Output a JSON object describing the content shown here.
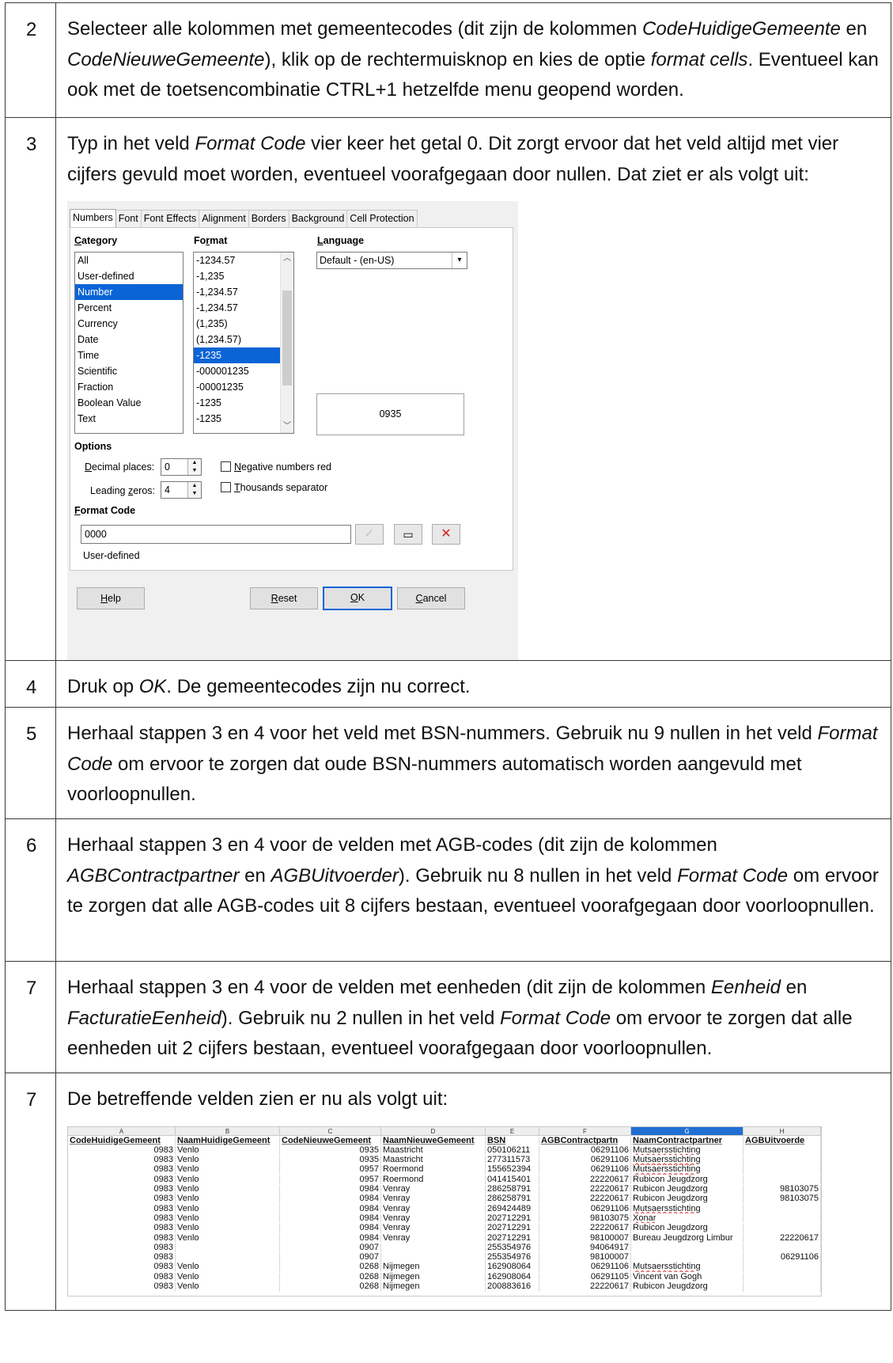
{
  "steps": [
    {
      "number": "2",
      "segments": [
        {
          "t": "Selecteer alle kolommen met gemeentecodes (dit zijn de kolommen "
        },
        {
          "t": "CodeHuidigeGemeente",
          "i": true
        },
        {
          "t": " en "
        },
        {
          "t": "CodeNieuweGemeente",
          "i": true
        },
        {
          "t": "), klik op de rechtermuisknop en kies de optie "
        },
        {
          "t": "format cells",
          "i": true
        },
        {
          "t": ". Eventueel kan ook met de toetsencombinatie CTRL+1 hetzelfde menu geopend worden."
        }
      ]
    },
    {
      "number": "3",
      "segments": [
        {
          "t": "Typ in het veld "
        },
        {
          "t": "Format Code",
          "i": true
        },
        {
          "t": " vier keer het getal 0. Dit zorgt ervoor dat het veld altijd met vier cijfers gevuld moet worden, eventueel voorafgegaan door nullen. Dat ziet er als volgt uit:"
        }
      ]
    },
    {
      "number": "4",
      "segments": [
        {
          "t": "Druk op "
        },
        {
          "t": "OK",
          "i": true
        },
        {
          "t": ". De gemeentecodes zijn nu correct."
        }
      ]
    },
    {
      "number": "5",
      "segments": [
        {
          "t": "Herhaal stappen 3 en 4 voor het veld met BSN-nummers. Gebruik nu 9 nullen in het veld "
        },
        {
          "t": "Format Code",
          "i": true
        },
        {
          "t": " om ervoor te zorgen dat oude BSN-nummers automatisch worden aangevuld met voorloopnullen."
        }
      ]
    },
    {
      "number": "6",
      "segments": [
        {
          "t": "Herhaal stappen 3 en 4 voor de velden met AGB-codes (dit zijn de kolommen "
        },
        {
          "t": "AGBContractpartner",
          "i": true
        },
        {
          "t": " en "
        },
        {
          "t": "AGBUitvoerder",
          "i": true
        },
        {
          "t": "). Gebruik nu 8 nullen in het veld "
        },
        {
          "t": "Format Code",
          "i": true
        },
        {
          "t": " om ervoor te zorgen dat alle AGB-codes uit 8 cijfers bestaan, eventueel voorafgegaan door voorloopnullen."
        }
      ]
    },
    {
      "number": "7",
      "segments": [
        {
          "t": "Herhaal stappen 3 en 4 voor de velden met eenheden (dit zijn de kolommen "
        },
        {
          "t": "Eenheid",
          "i": true
        },
        {
          "t": " en "
        },
        {
          "t": "FacturatieEenheid",
          "i": true
        },
        {
          "t": "). Gebruik nu 2 nullen in het veld "
        },
        {
          "t": "Format Code",
          "i": true
        },
        {
          "t": " om ervoor te zorgen dat alle eenheden uit 2 cijfers bestaan, eventueel voorafgegaan door voorloopnullen."
        }
      ]
    },
    {
      "number": "7",
      "segments": [
        {
          "t": "De betreffende velden zien er nu als volgt uit:"
        }
      ]
    }
  ],
  "dialog": {
    "tabs": [
      "Numbers",
      "Font",
      "Font Effects",
      "Alignment",
      "Borders",
      "Background",
      "Cell Protection"
    ],
    "active_tab": "Numbers",
    "category_label": "Category",
    "categories": [
      "All",
      "User-defined",
      "Number",
      "Percent",
      "Currency",
      "Date",
      "Time",
      "Scientific",
      "Fraction",
      "Boolean Value",
      "Text"
    ],
    "selected_category": "Number",
    "format_label": "Format",
    "formats": [
      "-1234.57",
      "-1,235",
      "-1,234.57",
      "-1,234.57",
      "(1,235)",
      "(1,234.57)",
      "-1235",
      "-000001235",
      "-00001235",
      "-1235",
      "-1235"
    ],
    "selected_format_index": 6,
    "language_label": "Language",
    "language_value": "Default - (en-US)",
    "preview_value": "0935",
    "options_label": "Options",
    "decimal_places_label": "Decimal places:",
    "decimal_places_value": "0",
    "leading_zeros_label": "Leading zeros:",
    "leading_zeros_value": "4",
    "negative_red_label": "Negative numbers red",
    "thousands_label": "Thousands separator",
    "format_code_label": "Format Code",
    "format_code_value": "0000",
    "format_type": "User-defined",
    "buttons": {
      "help": "Help",
      "reset": "Reset",
      "ok": "OK",
      "cancel": "Cancel"
    }
  },
  "spreadsheet": {
    "column_letters": [
      "A",
      "B",
      "C",
      "D",
      "E",
      "F",
      "G",
      "H"
    ],
    "selected_column": "G",
    "headers": [
      "CodeHuidigeGemeent",
      "NaamHuidigeGemeent",
      "CodeNieuweGemeent",
      "NaamNieuweGemeent",
      "BSN",
      "AGBContractpartn",
      "NaamContractpartner",
      "AGBUitvoerde"
    ],
    "rows": [
      [
        "0983",
        "Venlo",
        "0935",
        "Maastricht",
        "050106211",
        "06291106",
        "Mutsaersstichting",
        ""
      ],
      [
        "0983",
        "Venlo",
        "0935",
        "Maastricht",
        "277311573",
        "06291106",
        "Mutsaersstichting",
        ""
      ],
      [
        "0983",
        "Venlo",
        "0957",
        "Roermond",
        "155652394",
        "06291106",
        "Mutsaersstichting",
        ""
      ],
      [
        "0983",
        "Venlo",
        "0957",
        "Roermond",
        "041415401",
        "22220617",
        "Rubicon Jeugdzorg",
        ""
      ],
      [
        "0983",
        "Venlo",
        "0984",
        "Venray",
        "286258791",
        "22220617",
        "Rubicon Jeugdzorg",
        "98103075"
      ],
      [
        "0983",
        "Venlo",
        "0984",
        "Venray",
        "286258791",
        "22220617",
        "Rubicon Jeugdzorg",
        "98103075"
      ],
      [
        "0983",
        "Venlo",
        "0984",
        "Venray",
        "269424489",
        "06291106",
        "Mutsaersstichting",
        ""
      ],
      [
        "0983",
        "Venlo",
        "0984",
        "Venray",
        "202712291",
        "98103075",
        "Xonar",
        ""
      ],
      [
        "0983",
        "Venlo",
        "0984",
        "Venray",
        "202712291",
        "22220617",
        "Rubicon Jeugdzorg",
        ""
      ],
      [
        "0983",
        "Venlo",
        "0984",
        "Venray",
        "202712291",
        "98100007",
        "Bureau Jeugdzorg Limbur",
        "22220617"
      ],
      [
        "0983",
        "",
        "0907",
        "",
        "255354976",
        "94064917",
        "",
        ""
      ],
      [
        "0983",
        "",
        "0907",
        "",
        "255354976",
        "98100007",
        "",
        "06291106"
      ],
      [
        "0983",
        "Venlo",
        "0268",
        "Nijmegen",
        "162908064",
        "06291106",
        "Mutsaersstichting",
        ""
      ],
      [
        "0983",
        "Venlo",
        "0268",
        "Nijmegen",
        "162908064",
        "06291105",
        "Vincent van Gogh",
        ""
      ],
      [
        "0983",
        "Venlo",
        "0268",
        "Nijmegen",
        "200883616",
        "22220617",
        "Rubicon Jeugdzorg",
        ""
      ]
    ]
  }
}
